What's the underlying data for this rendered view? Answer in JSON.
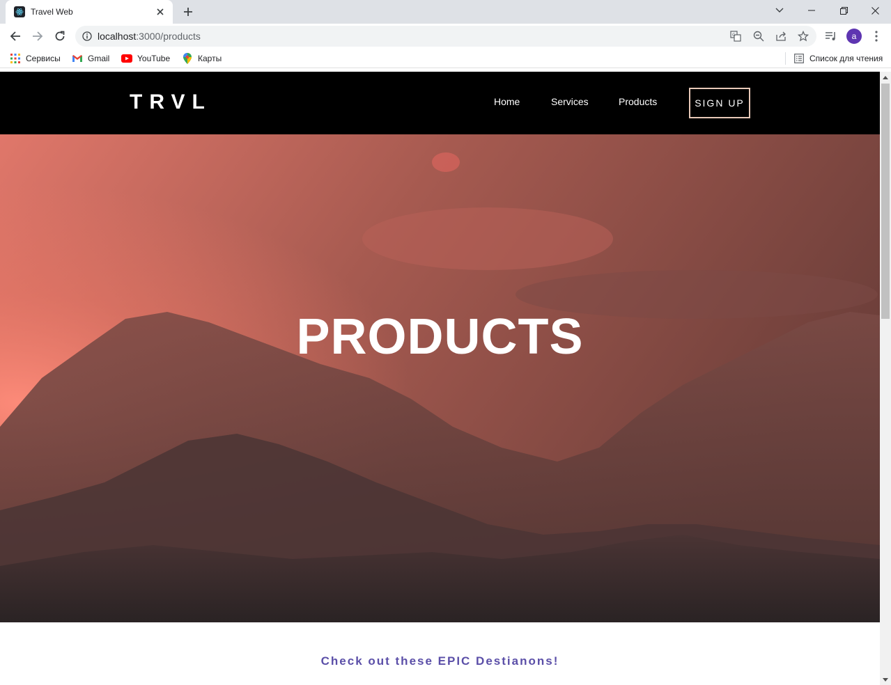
{
  "browser": {
    "tab_title": "Travel Web",
    "url_host": "localhost",
    "url_path": ":3000/products",
    "bookmarks": [
      {
        "label": "Сервисы",
        "icon": "apps-grid-icon"
      },
      {
        "label": "Gmail",
        "icon": "gmail-icon"
      },
      {
        "label": "YouTube",
        "icon": "youtube-icon"
      },
      {
        "label": "Карты",
        "icon": "maps-icon"
      }
    ],
    "reading_list": "Список для чтения",
    "avatar_letter": "a"
  },
  "site": {
    "logo": "TRVL",
    "nav": {
      "home": "Home",
      "services": "Services",
      "products": "Products",
      "signup": "SIGN UP"
    },
    "hero_title": "PRODUCTS",
    "tagline": "Check out these EPIC Destianons!"
  },
  "colors": {
    "navbar_bg": "#000000",
    "signup_border": "#e8c9b8",
    "tagline": "#5b4fa8",
    "hero_sky": "#c0655a"
  }
}
